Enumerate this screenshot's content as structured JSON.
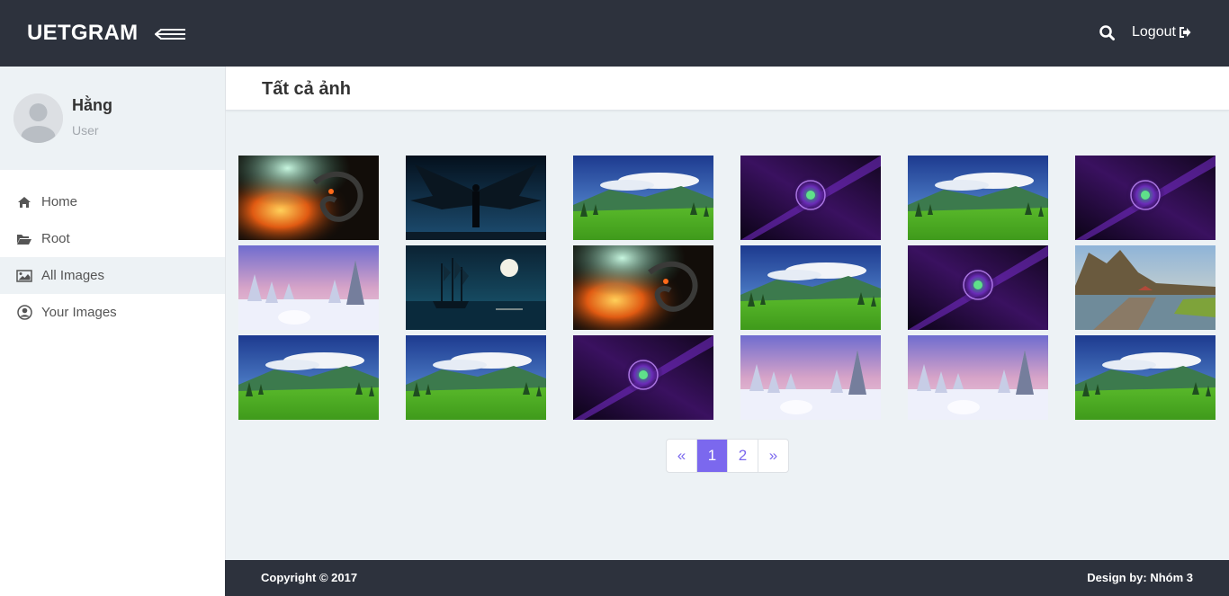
{
  "header": {
    "brand": "UETGRAM",
    "logout_label": "Logout",
    "icons": {
      "menu": "hamburger-arrow-icon",
      "search": "search-icon",
      "logout": "sign-out-icon"
    }
  },
  "sidebar": {
    "user": {
      "name": "Hằng",
      "role": "User",
      "avatar": "default-avatar"
    },
    "items": [
      {
        "label": "Home",
        "icon": "home-icon",
        "active": false
      },
      {
        "label": "Root",
        "icon": "folder-open-icon",
        "active": false
      },
      {
        "label": "All Images",
        "icon": "image-icon",
        "active": true
      },
      {
        "label": "Your Images",
        "icon": "user-circle-icon",
        "active": false
      }
    ]
  },
  "main": {
    "title": "Tất cả ảnh",
    "images": [
      {
        "theme": "dragon-fire"
      },
      {
        "theme": "dark-angel"
      },
      {
        "theme": "mountain-meadow"
      },
      {
        "theme": "purple-orb"
      },
      {
        "theme": "mountain-meadow"
      },
      {
        "theme": "purple-orb"
      },
      {
        "theme": "snow-forest"
      },
      {
        "theme": "ghost-ship-moon"
      },
      {
        "theme": "dragon-fire"
      },
      {
        "theme": "mountain-meadow"
      },
      {
        "theme": "purple-orb"
      },
      {
        "theme": "lake-boardwalk"
      },
      {
        "theme": "mountain-meadow"
      },
      {
        "theme": "mountain-meadow"
      },
      {
        "theme": "purple-orb"
      },
      {
        "theme": "snow-forest"
      },
      {
        "theme": "snow-forest"
      },
      {
        "theme": "mountain-meadow"
      }
    ],
    "pagination": {
      "prev": "«",
      "pages": [
        "1",
        "2"
      ],
      "next": "»",
      "current": "1"
    }
  },
  "footer": {
    "copyright": "Copyright © 2017",
    "design_by": "Design by: Nhóm 3"
  },
  "colors": {
    "topbar": "#2d323d",
    "accent": "#7b68ee",
    "background": "#edf2f5"
  }
}
